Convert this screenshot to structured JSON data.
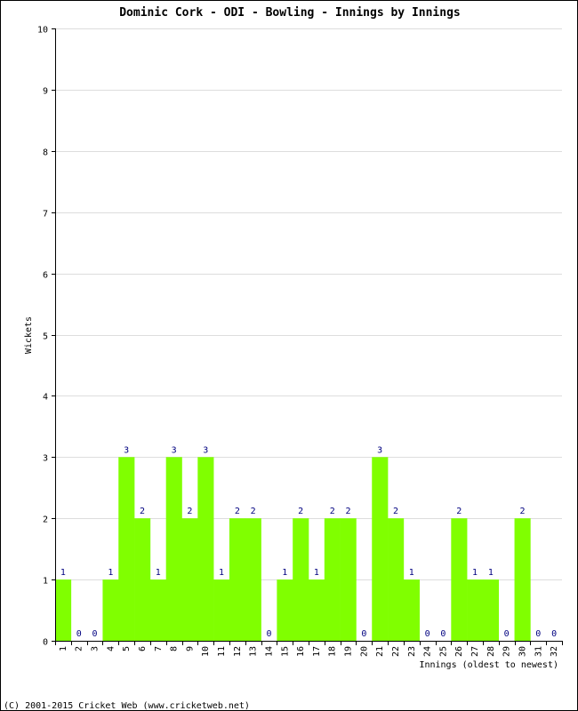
{
  "chart_data": {
    "type": "bar",
    "title": "Dominic Cork - ODI - Bowling - Innings by Innings",
    "xlabel": "Innings (oldest to newest)",
    "ylabel": "Wickets",
    "ylim": [
      0,
      10
    ],
    "yticks": [
      "0",
      "1",
      "2",
      "3",
      "4",
      "5",
      "6",
      "7",
      "8",
      "9",
      "10"
    ],
    "grid": true,
    "categories": [
      "1",
      "2",
      "3",
      "4",
      "5",
      "6",
      "7",
      "8",
      "9",
      "10",
      "11",
      "12",
      "13",
      "14",
      "15",
      "16",
      "17",
      "18",
      "19",
      "20",
      "21",
      "22",
      "23",
      "24",
      "25",
      "26",
      "27",
      "28",
      "29",
      "30",
      "31",
      "32"
    ],
    "values": [
      1,
      0,
      0,
      1,
      3,
      2,
      1,
      3,
      2,
      3,
      1,
      2,
      2,
      0,
      1,
      2,
      1,
      2,
      2,
      0,
      3,
      2,
      1,
      0,
      0,
      2,
      1,
      1,
      0,
      2,
      0,
      0
    ],
    "bar_color": "#80ff00",
    "label_color": "#000080",
    "grid_color": "#dddddd"
  },
  "footer": "(C) 2001-2015 Cricket Web (www.cricketweb.net)"
}
